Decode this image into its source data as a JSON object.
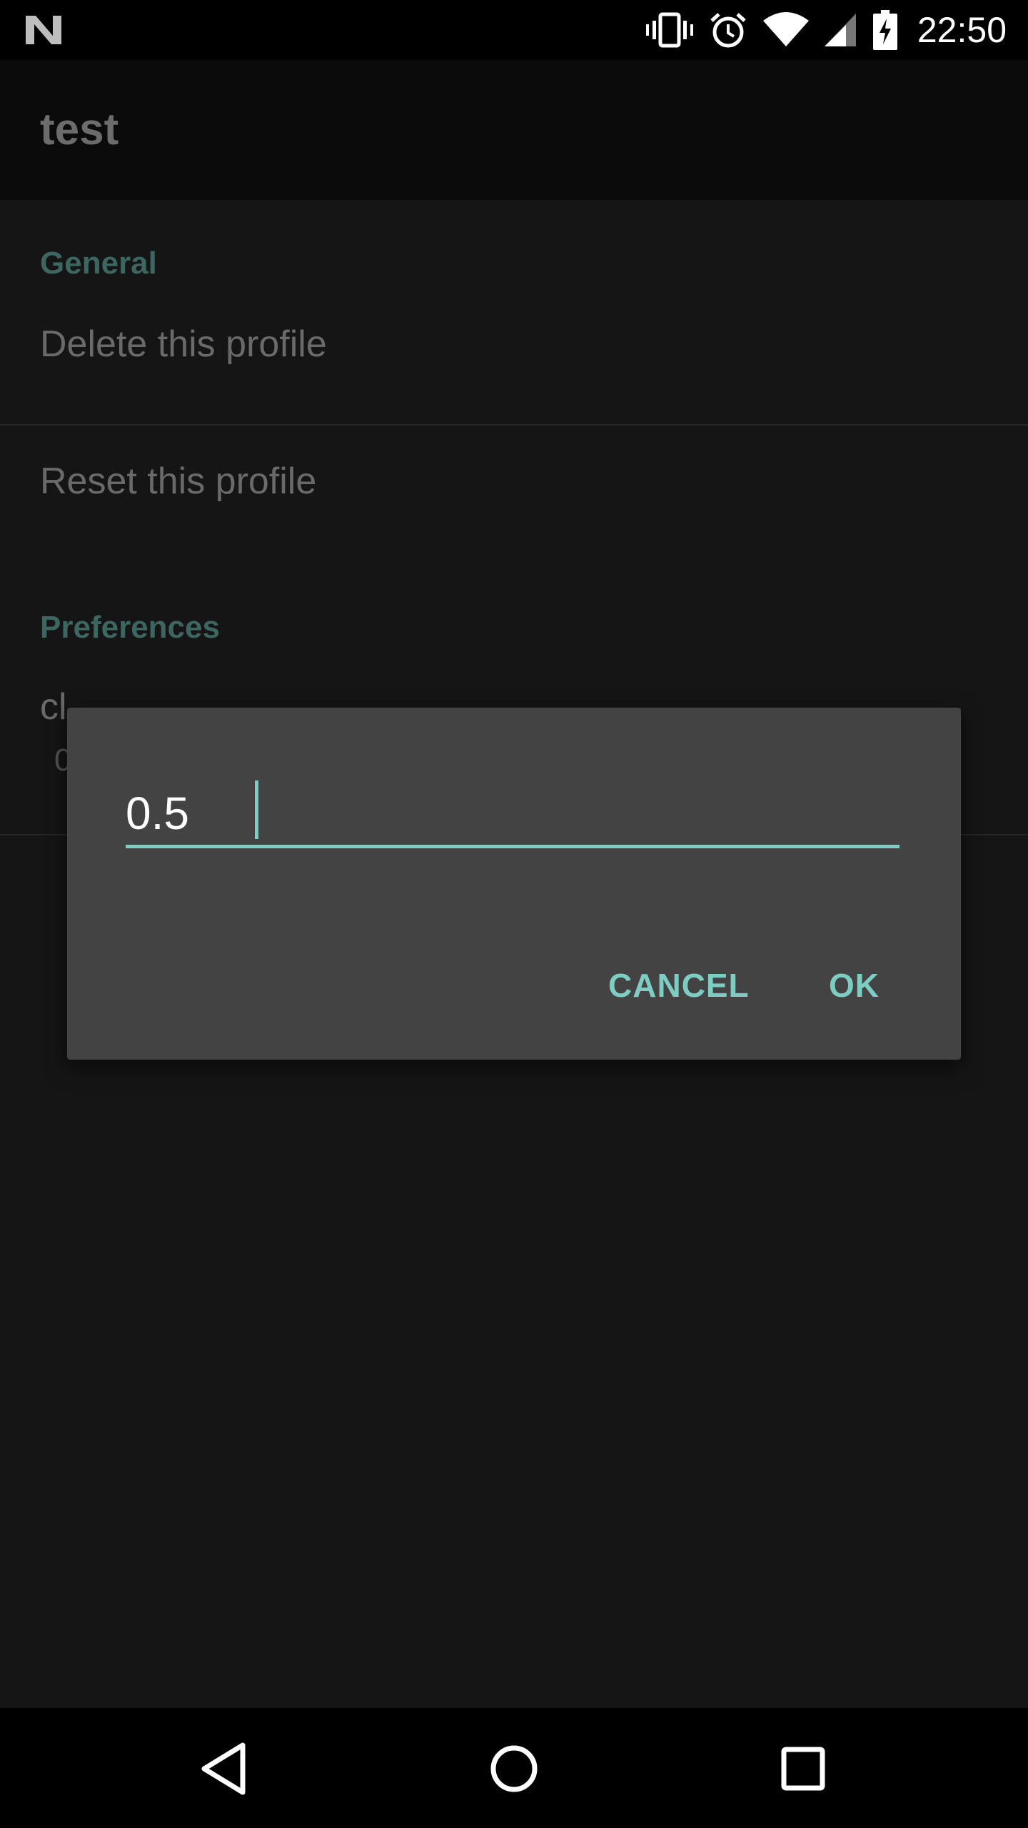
{
  "status_bar": {
    "time": "22:50",
    "icons": [
      "n-logo-icon",
      "vibrate-icon",
      "alarm-icon",
      "wifi-icon",
      "signal-icon",
      "battery-charging-icon"
    ]
  },
  "toolbar": {
    "title": "test"
  },
  "preferences": {
    "general_header": "General",
    "delete_profile": "Delete this profile",
    "reset_profile": "Reset this profile",
    "preferences_header": "Preferences",
    "partial_title": "cl",
    "partial_summary": "0"
  },
  "dialog": {
    "input_value": "0.5",
    "cancel_label": "CANCEL",
    "ok_label": "OK"
  },
  "colors": {
    "accent": "#7ecdc3",
    "category": "#3d6660",
    "dialog_bg": "#434343"
  },
  "nav_bar": {
    "icons": [
      "back-icon",
      "home-icon",
      "recents-icon"
    ]
  }
}
